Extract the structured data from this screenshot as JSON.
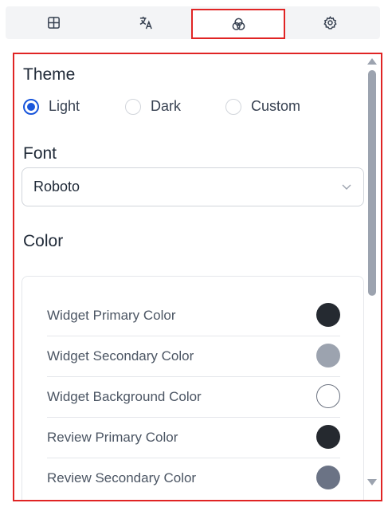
{
  "tabs": [
    {
      "icon": "layout-grid-icon"
    },
    {
      "icon": "translate-icon"
    },
    {
      "icon": "color-circles-icon",
      "active": true
    },
    {
      "icon": "gear-icon"
    }
  ],
  "theme": {
    "title": "Theme",
    "options": [
      {
        "label": "Light",
        "checked": true
      },
      {
        "label": "Dark",
        "checked": false
      },
      {
        "label": "Custom",
        "checked": false
      }
    ]
  },
  "font": {
    "title": "Font",
    "selected": "Roboto"
  },
  "color": {
    "title": "Color",
    "rows": [
      {
        "label": "Widget Primary Color",
        "value": "#252a31"
      },
      {
        "label": "Widget Secondary Color",
        "value": "#9ca3af"
      },
      {
        "label": "Widget Background Color",
        "value": "#ffffff"
      },
      {
        "label": "Review Primary Color",
        "value": "#25292f"
      },
      {
        "label": "Review Secondary Color",
        "value": "#6b7385"
      }
    ]
  },
  "colors": {
    "accent_red": "#e02424",
    "radio_blue": "#1a56db"
  }
}
